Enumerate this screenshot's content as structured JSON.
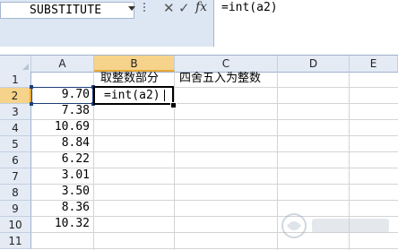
{
  "formula_bar": {
    "name_box": "SUBSTITUTE",
    "cancel_icon": "✕",
    "enter_icon": "✓",
    "fx_icon": "fx",
    "formula": "=int(a2)"
  },
  "columns": [
    "A",
    "B",
    "C",
    "D",
    "E"
  ],
  "rows": [
    "1",
    "2",
    "3",
    "4",
    "5",
    "6",
    "7",
    "8",
    "9",
    "10",
    "11"
  ],
  "cells": {
    "B1": "取整数部分",
    "C1": "四舍五入为整数",
    "A": [
      "9.70",
      "7.38",
      "10.69",
      "8.84",
      "6.22",
      "3.01",
      "3.50",
      "8.36",
      "10.32"
    ],
    "B2_editing": "=int(a2)"
  },
  "selection": {
    "active_row": "2",
    "active_column": "B"
  },
  "colors": {
    "header_bg": "#e4ebf5",
    "selected_header": "#f6d38a",
    "grid": "#d4d4d4"
  }
}
